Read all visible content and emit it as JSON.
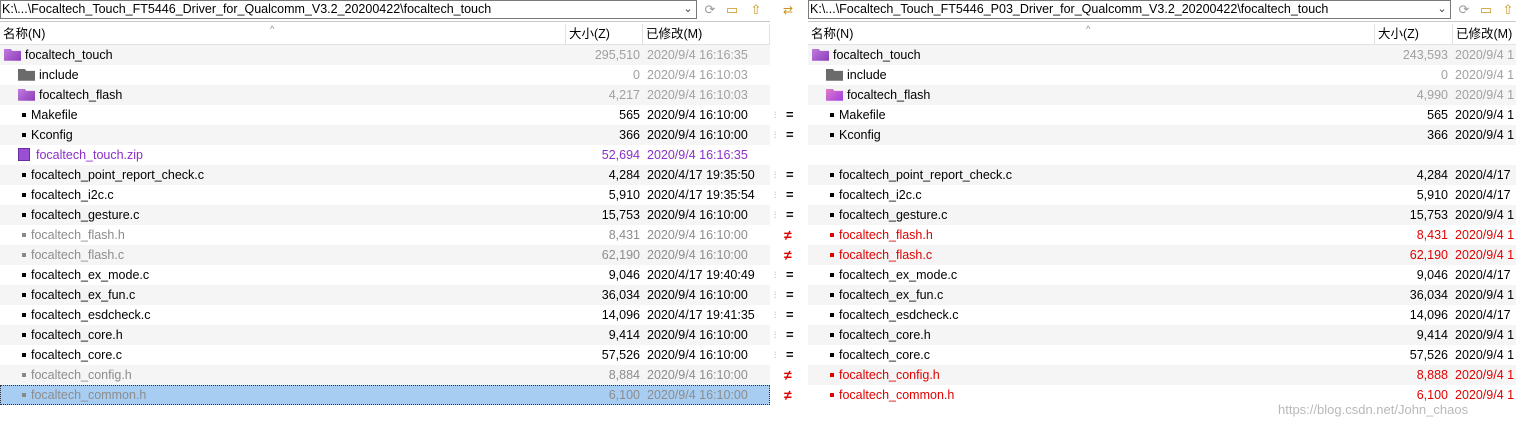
{
  "left": {
    "path": "K:\\...\\Focaltech_Touch_FT5446_Driver_for_Qualcomm_V3.2_20200422\\focaltech_touch",
    "headers": {
      "name": "名称(N)",
      "size": "大小(Z)",
      "date": "已修改(M)"
    },
    "rows": [
      {
        "name": "focaltech_touch",
        "size": "295,510",
        "date": "2020/9/4 16:16:35",
        "icon": "folder-open-icon",
        "style": "folder-root"
      },
      {
        "name": "include",
        "size": "0",
        "date": "2020/9/4 16:10:03",
        "icon": "folder-icon",
        "style": "folder-dim"
      },
      {
        "name": "focaltech_flash",
        "size": "4,217",
        "date": "2020/9/4 16:10:03",
        "icon": "folder-open-icon",
        "style": "folder-dim"
      },
      {
        "name": "Makefile",
        "size": "565",
        "date": "2020/9/4 16:10:00",
        "icon": "file-icon",
        "style": "normal"
      },
      {
        "name": "Kconfig",
        "size": "366",
        "date": "2020/9/4 16:10:00",
        "icon": "file-icon",
        "style": "normal"
      },
      {
        "name": "focaltech_touch.zip",
        "size": "52,694",
        "date": "2020/9/4 16:16:35",
        "icon": "zip-icon",
        "style": "orphan"
      },
      {
        "name": "focaltech_point_report_check.c",
        "size": "4,284",
        "date": "2020/4/17 19:35:50",
        "icon": "file-icon",
        "style": "normal"
      },
      {
        "name": "focaltech_i2c.c",
        "size": "5,910",
        "date": "2020/4/17 19:35:54",
        "icon": "file-icon",
        "style": "normal"
      },
      {
        "name": "focaltech_gesture.c",
        "size": "15,753",
        "date": "2020/9/4 16:10:00",
        "icon": "file-icon",
        "style": "normal"
      },
      {
        "name": "focaltech_flash.h",
        "size": "8,431",
        "date": "2020/9/4 16:10:00",
        "icon": "file-icon",
        "style": "grey"
      },
      {
        "name": "focaltech_flash.c",
        "size": "62,190",
        "date": "2020/9/4 16:10:00",
        "icon": "file-icon",
        "style": "grey"
      },
      {
        "name": "focaltech_ex_mode.c",
        "size": "9,046",
        "date": "2020/4/17 19:40:49",
        "icon": "file-icon",
        "style": "normal"
      },
      {
        "name": "focaltech_ex_fun.c",
        "size": "36,034",
        "date": "2020/9/4 16:10:00",
        "icon": "file-icon",
        "style": "normal"
      },
      {
        "name": "focaltech_esdcheck.c",
        "size": "14,096",
        "date": "2020/4/17 19:41:35",
        "icon": "file-icon",
        "style": "normal"
      },
      {
        "name": "focaltech_core.h",
        "size": "9,414",
        "date": "2020/9/4 16:10:00",
        "icon": "file-icon",
        "style": "normal"
      },
      {
        "name": "focaltech_core.c",
        "size": "57,526",
        "date": "2020/9/4 16:10:00",
        "icon": "file-icon",
        "style": "normal"
      },
      {
        "name": "focaltech_config.h",
        "size": "8,884",
        "date": "2020/9/4 16:10:00",
        "icon": "file-icon",
        "style": "grey"
      },
      {
        "name": "focaltech_common.h",
        "size": "6,100",
        "date": "2020/9/4 16:10:00",
        "icon": "file-icon",
        "style": "grey-selected"
      }
    ]
  },
  "right": {
    "path": "K:\\...\\Focaltech_Touch_FT5446_P03_Driver_for_Qualcomm_V3.2_20200422\\focaltech_touch",
    "headers": {
      "name": "名称(N)",
      "size": "大小(Z)",
      "date": "已修改(M)"
    },
    "rows": [
      {
        "name": "focaltech_touch",
        "size": "243,593",
        "date": "2020/9/4 1",
        "icon": "folder-open-icon",
        "style": "folder-root"
      },
      {
        "name": "include",
        "size": "0",
        "date": "2020/9/4 1",
        "icon": "folder-icon",
        "style": "folder-dim"
      },
      {
        "name": "focaltech_flash",
        "size": "4,990",
        "date": "2020/9/4 1",
        "icon": "folder-open-icon",
        "style": "folder-dim"
      },
      {
        "name": "Makefile",
        "size": "565",
        "date": "2020/9/4 1",
        "icon": "file-icon",
        "style": "normal"
      },
      {
        "name": "Kconfig",
        "size": "366",
        "date": "2020/9/4 1",
        "icon": "file-icon",
        "style": "normal"
      },
      {
        "name": "",
        "size": "",
        "date": "",
        "icon": "",
        "style": "empty"
      },
      {
        "name": "focaltech_point_report_check.c",
        "size": "4,284",
        "date": "2020/4/17",
        "icon": "file-icon",
        "style": "normal"
      },
      {
        "name": "focaltech_i2c.c",
        "size": "5,910",
        "date": "2020/4/17",
        "icon": "file-icon",
        "style": "normal"
      },
      {
        "name": "focaltech_gesture.c",
        "size": "15,753",
        "date": "2020/9/4 1",
        "icon": "file-icon",
        "style": "normal"
      },
      {
        "name": "focaltech_flash.h",
        "size": "8,431",
        "date": "2020/9/4 1",
        "icon": "file-icon",
        "style": "red"
      },
      {
        "name": "focaltech_flash.c",
        "size": "62,190",
        "date": "2020/9/4 1",
        "icon": "file-icon",
        "style": "red"
      },
      {
        "name": "focaltech_ex_mode.c",
        "size": "9,046",
        "date": "2020/4/17",
        "icon": "file-icon",
        "style": "normal"
      },
      {
        "name": "focaltech_ex_fun.c",
        "size": "36,034",
        "date": "2020/9/4 1",
        "icon": "file-icon",
        "style": "normal"
      },
      {
        "name": "focaltech_esdcheck.c",
        "size": "14,096",
        "date": "2020/4/17",
        "icon": "file-icon",
        "style": "normal"
      },
      {
        "name": "focaltech_core.h",
        "size": "9,414",
        "date": "2020/9/4 1",
        "icon": "file-icon",
        "style": "normal"
      },
      {
        "name": "focaltech_core.c",
        "size": "57,526",
        "date": "2020/9/4 1",
        "icon": "file-icon",
        "style": "normal"
      },
      {
        "name": "focaltech_config.h",
        "size": "8,888",
        "date": "2020/9/4 1",
        "icon": "file-icon",
        "style": "red"
      },
      {
        "name": "focaltech_common.h",
        "size": "6,100",
        "date": "2020/9/4 1",
        "icon": "file-icon",
        "style": "red"
      }
    ]
  },
  "gutter": [
    "",
    "",
    "",
    "same",
    "same",
    "",
    "same",
    "same",
    "same",
    "diff",
    "diff",
    "same",
    "same",
    "same",
    "same",
    "same",
    "diff",
    "diff"
  ],
  "glyphs": {
    "same_mark": "⫶≡",
    "eq": "=",
    "ne": "≠",
    "dropdown": "⌄",
    "sort": "^"
  },
  "watermark": "https://blog.csdn.net/John_chaos",
  "colors": {
    "diff": "#e00000",
    "orphan": "#8b2fc9",
    "selected": "#a8cdf2",
    "muted": "#a0a0a0"
  }
}
